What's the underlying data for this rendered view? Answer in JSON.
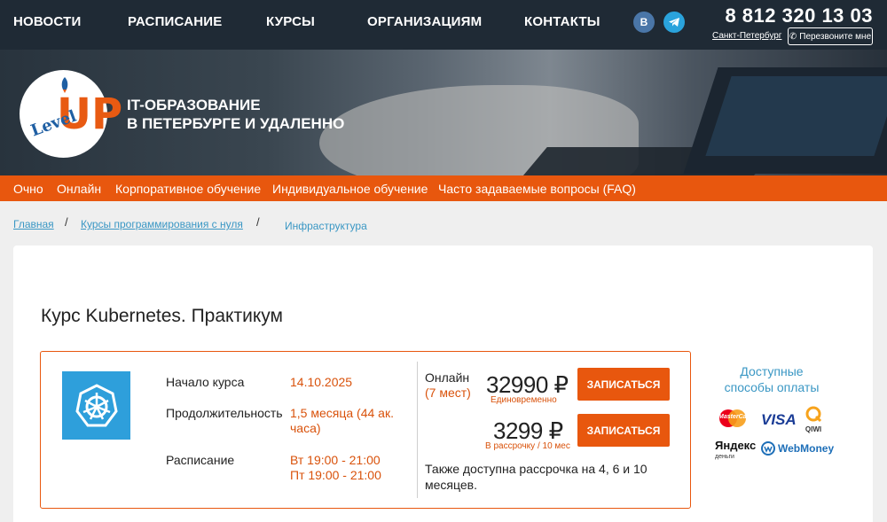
{
  "topnav": {
    "items": [
      "НОВОСТИ",
      "РАСПИСАНИЕ",
      "КУРСЫ",
      "ОРГАНИЗАЦИЯМ",
      "КОНТАКТЫ"
    ],
    "vk_label": "В",
    "phone": "8 812 320 13 03",
    "city": "Санкт-Петербург",
    "callback_label": "Перезвоните мне"
  },
  "banner": {
    "logo_level": "Level",
    "logo_up": "UP",
    "tagline_line1": "IT-ОБРАЗОВАНИЕ",
    "tagline_line2": "В ПЕТЕРБУРГЕ И УДАЛЕННО"
  },
  "submenu": [
    "Очно",
    "Онлайн",
    "Корпоративное обучение",
    "Индивидуальное обучение",
    "Часто задаваемые вопросы (FAQ)"
  ],
  "breadcrumb": {
    "home": "Главная",
    "courses": "Курсы программирования с нуля",
    "current": "Инфраструктура",
    "separator": "/"
  },
  "course": {
    "title": "Курс Kubernetes. Практикум",
    "start_label": "Начало курса",
    "start_value": "14.10.2025",
    "duration_label": "Продолжительность",
    "duration_line1": "1,5 месяца (44 ак.",
    "duration_line2": "часа)",
    "schedule_label": "Расписание",
    "schedule_line1": "Вт 19:00 - 21:00",
    "schedule_line2": "Пт 19:00 - 21:00"
  },
  "pricing": {
    "format_label": "Онлайн",
    "format_duration": "(7 мест)",
    "price_once": "32990 ₽",
    "price_once_sub": "Единовременно",
    "price_installment": "3299 ₽",
    "price_installment_sub": "В рассрочку / 10 мес",
    "enroll_label_1": "ЗАПИСАТЬСЯ",
    "enroll_label_2": "ЗАПИСАТЬСЯ",
    "note": "Также доступна рассрочка на 4, 6 и 10 месяцев."
  },
  "payment": {
    "title_line1": "Доступные",
    "title_line2": "способы оплаты",
    "mastercard": "MasterCard",
    "visa": "VISA",
    "qiwi": "QIWI",
    "yandex_line1": "Яндекс",
    "yandex_line2": "деньги",
    "webmoney": "WebMoney"
  }
}
